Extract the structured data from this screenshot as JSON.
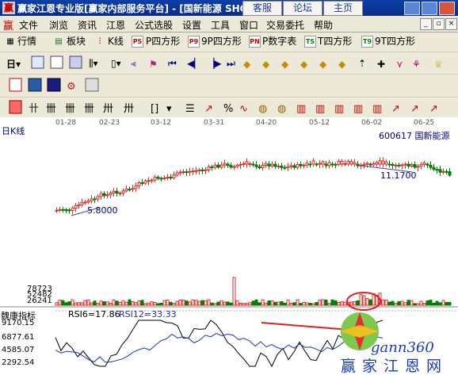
{
  "titlebar": {
    "app_title": "赢家江恩专业版[赢家内部服务平台] - [国新能源  SHC",
    "tabs": [
      "客服",
      "论坛",
      "主页"
    ]
  },
  "menu": [
    "文件",
    "浏览",
    "资讯",
    "江恩",
    "公式选股",
    "设置",
    "工具",
    "窗口",
    "交易委托",
    "帮助"
  ],
  "toolbar1": [
    "行情",
    "板块",
    "K线",
    "P四方形",
    "9P四方形",
    "P数字表",
    "T四方形",
    "9T四方形"
  ],
  "toolbar1_icons": [
    "PS",
    "P9",
    "PN",
    "TS",
    "T9"
  ],
  "chart": {
    "period": "日K线",
    "stock": "600617  国新能源",
    "dates": [
      "01-28",
      "02-23",
      "03-12",
      "03-31",
      "04-20",
      "05-12",
      "06-02",
      "06-25"
    ],
    "low_label": "5.8000",
    "high_label": "11.1700",
    "volume_ticks": [
      "78723",
      "52482",
      "26241"
    ],
    "indicator_name": "魏康指标",
    "rsi6": "RSI6=17.86",
    "rsi12": "RSI12=33.33",
    "indicator_ticks": [
      "9170.15",
      "6877.61",
      "4585.07",
      "2292.54"
    ]
  },
  "chart_data": {
    "type": "candlestick",
    "x_range": [
      "01-28",
      "06-25"
    ],
    "price_low": 5.8,
    "price_high": 11.17,
    "volume_ticks": [
      26241,
      52482,
      78723
    ],
    "indicator_ticks": [
      2292.54,
      4585.07,
      6877.61,
      9170.15
    ]
  },
  "watermark": {
    "site": "gann360",
    "tagline": "赢家江恩网"
  },
  "colors": {
    "up": "#e03030",
    "down": "#008000",
    "title_bg": "#0a2d8a",
    "rsi6_line": "#000000",
    "rsi12_line": "#2030c0"
  }
}
